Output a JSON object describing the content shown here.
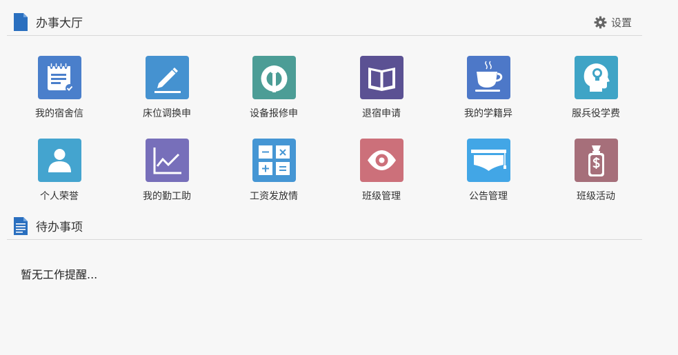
{
  "hall": {
    "title": "办事大厅",
    "settings_label": "设置"
  },
  "tiles": [
    {
      "label": "我的宿舍信",
      "icon": "notepad-icon",
      "color": "#4a7fcb"
    },
    {
      "label": "床位调换申",
      "icon": "pencil-icon",
      "color": "#4592d0"
    },
    {
      "label": "设备报修申",
      "icon": "wikimedia-icon",
      "color": "#4c9d96"
    },
    {
      "label": "退宿申请",
      "icon": "open-book-icon",
      "color": "#5b5193"
    },
    {
      "label": "我的学籍异",
      "icon": "coffee-cup-icon",
      "color": "#4d78c8"
    },
    {
      "label": "服兵役学费",
      "icon": "head-idea-icon",
      "color": "#3fa4c6"
    },
    {
      "label": "个人荣誉",
      "icon": "user-icon",
      "color": "#44a4cf"
    },
    {
      "label": "我的勤工助",
      "icon": "line-chart-icon",
      "color": "#776fba"
    },
    {
      "label": "工资发放情",
      "icon": "calculator-icon",
      "color": "#4596d4"
    },
    {
      "label": "班级管理",
      "icon": "eye-icon",
      "color": "#cc707a"
    },
    {
      "label": "公告管理",
      "icon": "graduation-cap-icon",
      "color": "#42a6e6"
    },
    {
      "label": "班级活动",
      "icon": "money-bag-icon",
      "color": "#a66f7a"
    }
  ],
  "todo": {
    "title": "待办事项",
    "empty_message": "暂无工作提醒..."
  }
}
